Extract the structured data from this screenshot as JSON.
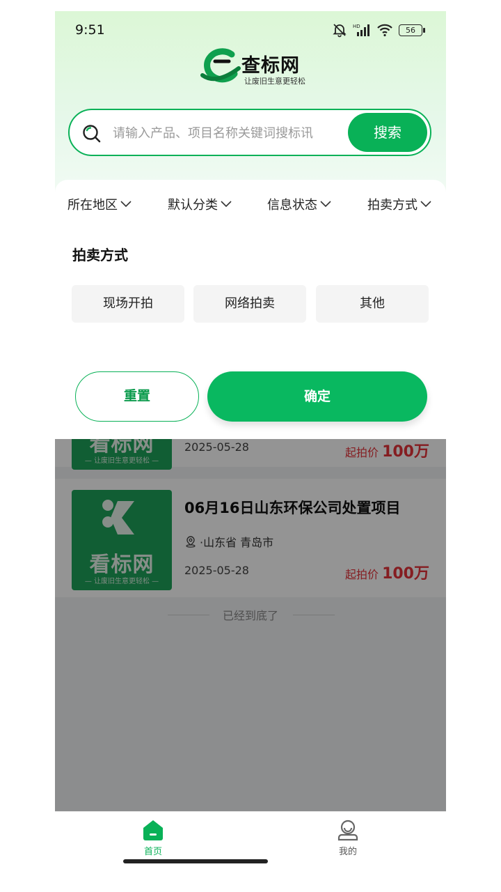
{
  "status_bar": {
    "time": "9:51",
    "battery": "56"
  },
  "logo": {
    "name": "查标网",
    "slogan": "让废旧生意更轻松"
  },
  "search": {
    "placeholder": "请输入产品、项目名称关键词搜标讯",
    "button": "搜索"
  },
  "filters": {
    "tabs": [
      {
        "label": "所在地区"
      },
      {
        "label": "默认分类"
      },
      {
        "label": "信息状态"
      },
      {
        "label": "拍卖方式"
      }
    ],
    "section_title": "拍卖方式",
    "options": [
      {
        "label": "现场开拍"
      },
      {
        "label": "网络拍卖"
      },
      {
        "label": "其他"
      }
    ],
    "reset_label": "重置",
    "confirm_label": "确定"
  },
  "listings": [
    {
      "brand": "看标网",
      "slogan": "— 让废旧生意更轻松 —",
      "date": "2025-05-28",
      "price_prefix": "起拍价",
      "price": "100万"
    },
    {
      "brand": "看标网",
      "slogan": "— 让废旧生意更轻松 —",
      "title": "06月16日山东环保公司处置项目",
      "location": "·山东省 青岛市",
      "date": "2025-05-28",
      "price_prefix": "起拍价",
      "price": "100万"
    }
  ],
  "end_text": "已经到底了",
  "bottom_nav": {
    "home": "首页",
    "mine": "我的"
  },
  "colors": {
    "accent": "#09b157",
    "price": "#e5333a"
  }
}
